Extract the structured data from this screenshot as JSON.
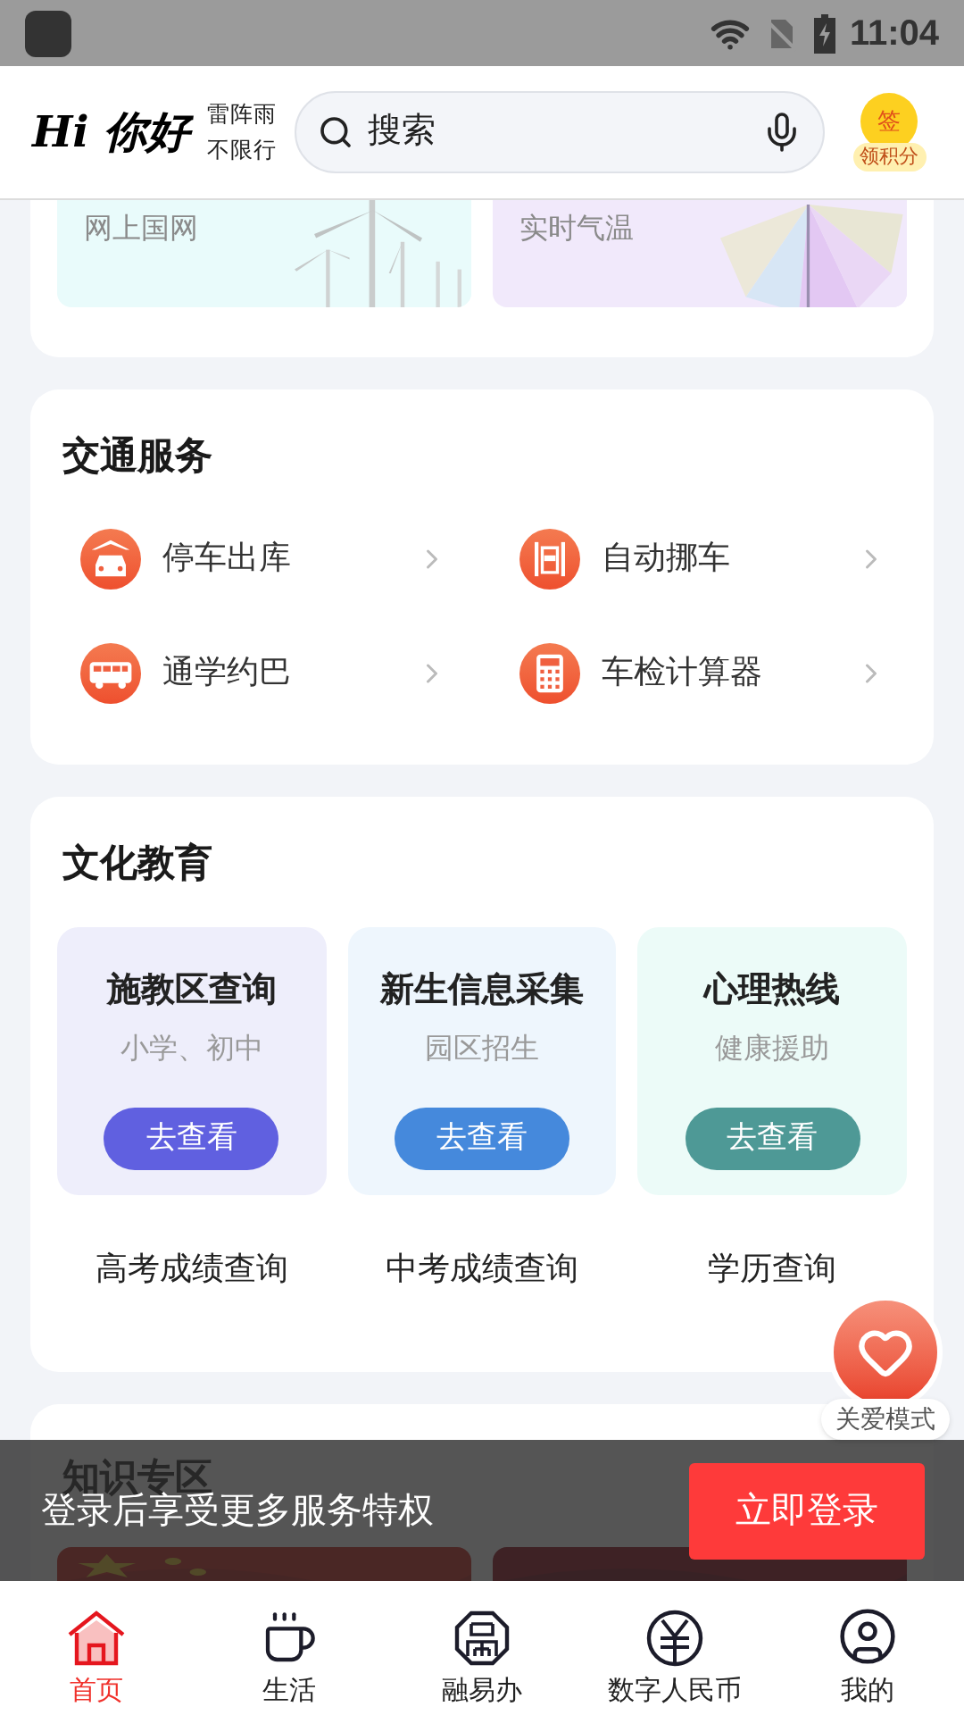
{
  "status_bar": {
    "time": "11:04"
  },
  "header": {
    "greeting": "Hi 你好",
    "weather": "雷阵雨",
    "traffic": "不限行",
    "search": {
      "placeholder": "搜索"
    },
    "checkin": {
      "badge": "签",
      "label": "领积分"
    }
  },
  "top_banners": [
    {
      "label": "网上国网",
      "kind": "turbine"
    },
    {
      "label": "实时气温",
      "kind": "umbrella"
    }
  ],
  "transport": {
    "title": "交通服务",
    "items": [
      {
        "label": "停车出库",
        "kind": "car"
      },
      {
        "label": "自动挪车",
        "kind": "parking"
      },
      {
        "label": "通学约巴",
        "kind": "bus"
      },
      {
        "label": "车检计算器",
        "kind": "calculator"
      }
    ]
  },
  "education": {
    "title": "文化教育",
    "cards": [
      {
        "title": "施教区查询",
        "subtitle": "小学、初中",
        "button": "去查看",
        "color": "#6060e0"
      },
      {
        "title": "新生信息采集",
        "subtitle": "园区招生",
        "button": "去查看",
        "color": "#4589dc"
      },
      {
        "title": "心理热线",
        "subtitle": "健康援助",
        "button": "去查看",
        "color": "#4e9996"
      }
    ],
    "links": [
      "高考成绩查询",
      "中考成绩查询",
      "学历查询"
    ]
  },
  "knowledge": {
    "title": "知识专区"
  },
  "login_bar": {
    "text": "登录后享受更多服务特权",
    "button": "立即登录"
  },
  "care_mode": {
    "label": "关爱模式"
  },
  "nav": [
    {
      "label": "首页",
      "kind": "home",
      "selected": true
    },
    {
      "label": "生活",
      "kind": "cup",
      "selected": false
    },
    {
      "label": "融易办",
      "kind": "octagon",
      "selected": false
    },
    {
      "label": "数字人民币",
      "kind": "yuan",
      "selected": false
    },
    {
      "label": "我的",
      "kind": "user",
      "selected": false
    }
  ]
}
